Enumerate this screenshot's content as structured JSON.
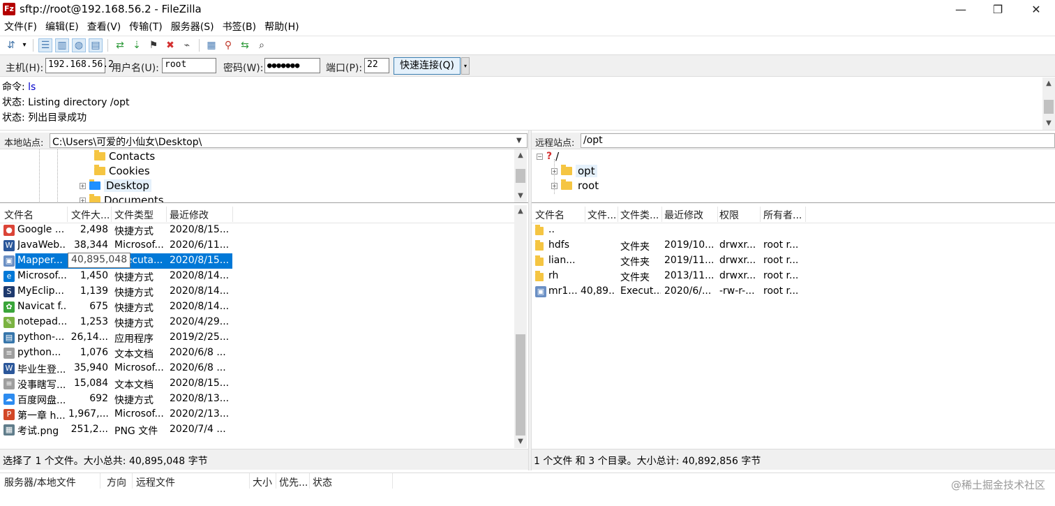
{
  "window": {
    "title": "sftp://root@192.168.56.2 - FileZilla",
    "app_icon_label": "Fz",
    "controls": {
      "minimize": "—",
      "maximize": "❐",
      "close": "✕"
    }
  },
  "menu": [
    "文件(F)",
    "编辑(E)",
    "查看(V)",
    "传输(T)",
    "服务器(S)",
    "书签(B)",
    "帮助(H)"
  ],
  "toolbar": {
    "icons": [
      "site-manager-icon",
      "dropdown-arrow-icon",
      "toggle-log-icon",
      "toggle-local-tree-icon",
      "toggle-remote-tree-icon",
      "toggle-queue-icon",
      "refresh-icon",
      "process-queue-icon",
      "cancel-icon",
      "disconnect-icon",
      "reconnect-icon",
      "filter-icon",
      "compare-icon",
      "sync-browse-icon",
      "search-icon"
    ]
  },
  "quickconnect": {
    "host_label": "主机(H):",
    "host_value": "192.168.56.2",
    "user_label": "用户名(U):",
    "user_value": "root",
    "pass_label": "密码(W):",
    "pass_value": "●●●●●●●",
    "port_label": "端口(P):",
    "port_value": "22",
    "button_label": "快速连接(Q)",
    "dropdown": "▾"
  },
  "log": [
    {
      "label": "命令:",
      "text": "ls",
      "kind": "cmd"
    },
    {
      "label": "状态:",
      "text": "Listing directory /opt",
      "kind": "status"
    },
    {
      "label": "状态:",
      "text": "列出目录成功",
      "kind": "status"
    }
  ],
  "local": {
    "site_label": "本地站点:",
    "site_path": "C:\\Users\\可爱的小仙女\\Desktop\\",
    "tree": [
      "Contacts",
      "Cookies",
      "Desktop",
      "Documents"
    ],
    "headers": [
      "文件名",
      "文件大...",
      "文件类型",
      "最近修改"
    ],
    "files": [
      {
        "name": "Google ...",
        "size": "2,498",
        "type": "快捷方式",
        "modified": "2020/8/15...",
        "icon": "chrome-icon",
        "color": "#db4437",
        "glyph": "●"
      },
      {
        "name": "JavaWeb...",
        "size": "38,344",
        "type": "Microsof...",
        "modified": "2020/6/11...",
        "icon": "word-icon",
        "color": "#2b579a",
        "glyph": "W"
      },
      {
        "name": "Mapper...",
        "size": "40,895,048",
        "type": "Executa...",
        "modified": "2020/8/15...",
        "icon": "installer-icon",
        "color": "#6a8fc4",
        "glyph": "▣"
      },
      {
        "name": "Microsof...",
        "size": "1,450",
        "type": "快捷方式",
        "modified": "2020/8/14...",
        "icon": "edge-icon",
        "color": "#0078d7",
        "glyph": "e"
      },
      {
        "name": "MyEclip...",
        "size": "1,139",
        "type": "快捷方式",
        "modified": "2020/8/14...",
        "icon": "myeclipse-icon",
        "color": "#1e3a6e",
        "glyph": "S"
      },
      {
        "name": "Navicat f...",
        "size": "675",
        "type": "快捷方式",
        "modified": "2020/8/14...",
        "icon": "navicat-icon",
        "color": "#3aa53a",
        "glyph": "✿"
      },
      {
        "name": "notepad...",
        "size": "1,253",
        "type": "快捷方式",
        "modified": "2020/4/29...",
        "icon": "notepad-icon",
        "color": "#7bb342",
        "glyph": "✎"
      },
      {
        "name": "python-...",
        "size": "26,14...",
        "type": "应用程序",
        "modified": "2019/2/25...",
        "icon": "python-icon",
        "color": "#3776ab",
        "glyph": "▤"
      },
      {
        "name": "python...",
        "size": "1,076",
        "type": "文本文档",
        "modified": "2020/6/8 ...",
        "icon": "text-file-icon",
        "color": "#9e9e9e",
        "glyph": "≡"
      },
      {
        "name": "毕业生登...",
        "size": "35,940",
        "type": "Microsof...",
        "modified": "2020/6/8 ...",
        "icon": "word-icon",
        "color": "#2b579a",
        "glyph": "W"
      },
      {
        "name": "没事瞎写...",
        "size": "15,084",
        "type": "文本文档",
        "modified": "2020/8/15...",
        "icon": "text-file-icon",
        "color": "#9e9e9e",
        "glyph": "≡"
      },
      {
        "name": "百度网盘...",
        "size": "692",
        "type": "快捷方式",
        "modified": "2020/8/13...",
        "icon": "baidu-netdisk-icon",
        "color": "#2d8cf0",
        "glyph": "☁"
      },
      {
        "name": "第一章  h...",
        "size": "1,967,...",
        "type": "Microsof...",
        "modified": "2020/2/13...",
        "icon": "powerpoint-icon",
        "color": "#d24726",
        "glyph": "P"
      },
      {
        "name": "考试.png",
        "size": "251,2...",
        "type": "PNG 文件",
        "modified": "2020/7/4 ...",
        "icon": "image-file-icon",
        "color": "#607d8b",
        "glyph": "▦"
      }
    ],
    "selected_index": 2,
    "tooltip": "40,895,048",
    "status": "选择了 1 个文件。大小总共: 40,895,048 字节"
  },
  "remote": {
    "site_label": "远程站点:",
    "site_path": "/opt",
    "tree": [
      {
        "name": "/",
        "level": 0,
        "expander": "⊟",
        "kind": "unknown"
      },
      {
        "name": "opt",
        "level": 1,
        "expander": "⊞",
        "kind": "folder"
      },
      {
        "name": "root",
        "level": 1,
        "expander": "⊞",
        "kind": "folder"
      }
    ],
    "headers": [
      "文件名",
      "文件...",
      "文件类...",
      "最近修改",
      "权限",
      "所有者..."
    ],
    "files": [
      {
        "name": "..",
        "size": "",
        "type": "",
        "modified": "",
        "perms": "",
        "owner": "",
        "kind": "folder"
      },
      {
        "name": "hdfs",
        "size": "",
        "type": "文件夹",
        "modified": "2019/10...",
        "perms": "drwxr...",
        "owner": "root r...",
        "kind": "folder"
      },
      {
        "name": "lian...",
        "size": "",
        "type": "文件夹",
        "modified": "2019/11...",
        "perms": "drwxr...",
        "owner": "root r...",
        "kind": "folder"
      },
      {
        "name": "rh",
        "size": "",
        "type": "文件夹",
        "modified": "2013/11...",
        "perms": "drwxr...",
        "owner": "root r...",
        "kind": "folder"
      },
      {
        "name": "mr1...",
        "size": "40,89...",
        "type": "Execut...",
        "modified": "2020/6/...",
        "perms": "-rw-r-...",
        "owner": "root r...",
        "kind": "file"
      }
    ],
    "status": "1 个文件 和 3 个目录。大小总计: 40,892,856 字节"
  },
  "queue": {
    "headers": [
      "服务器/本地文件",
      "方向",
      "远程文件",
      "大小",
      "优先...",
      "状态"
    ]
  },
  "watermark": "@稀土掘金技术社区"
}
